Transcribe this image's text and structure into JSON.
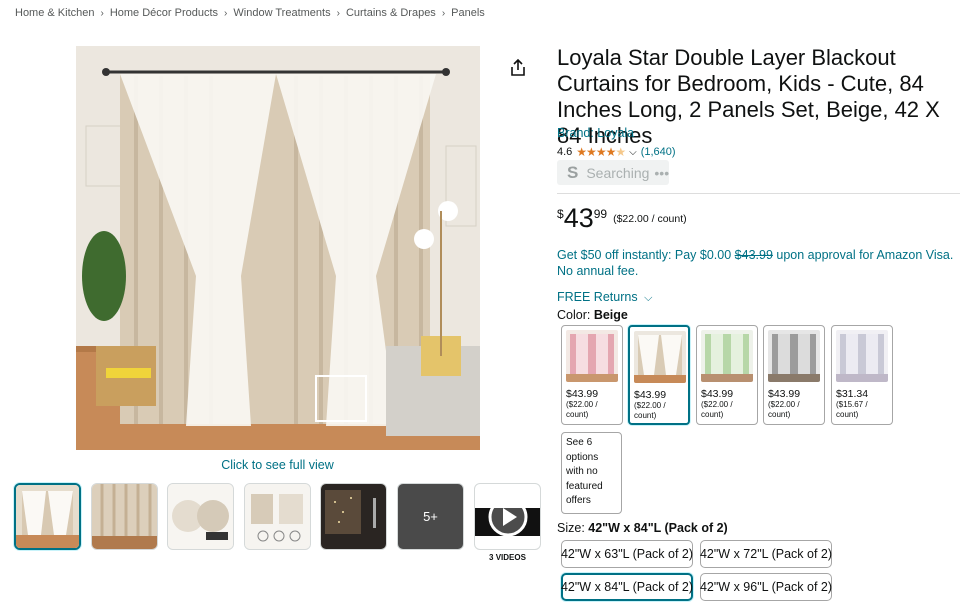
{
  "breadcrumb": [
    "Home & Kitchen",
    "Home Décor Products",
    "Window Treatments",
    "Curtains & Drapes",
    "Panels"
  ],
  "gallery": {
    "click_full_view": "Click to see full view",
    "more_count": "5+",
    "videos_label": "3 VIDEOS"
  },
  "product": {
    "title": "Loyala Star Double Layer Blackout Curtains for Bedroom, Kids - Cute, 84 Inches Long, 2 Panels Set, Beige, 42 X 84 Inches",
    "brand": "Brand: Loyala",
    "rating": "4.6",
    "rating_count": "(1,640)",
    "searching": "Searching",
    "price_symbol": "$",
    "price_whole": "43",
    "price_fraction": "99",
    "price_per_unit": "($22.00 / count)",
    "promo_prefix": "Get $50 off instantly: Pay $0.00 ",
    "promo_strike": "$43.99",
    "promo_suffix": " upon approval for Amazon Visa. No annual fee.",
    "free_returns": "FREE Returns",
    "color_label": "Color: ",
    "color_value": "Beige",
    "size_label": "Size: ",
    "size_value": "42\"W x 84\"L (Pack of 2)"
  },
  "swatches": [
    {
      "price": "$43.99",
      "unit": "($22.00 / count)",
      "color": "#e4a6b0"
    },
    {
      "price": "$43.99",
      "unit": "($22.00 / count)",
      "color": "#e6dccb"
    },
    {
      "price": "$43.99",
      "unit": "($22.00 / count)",
      "color": "#b7d7a8"
    },
    {
      "price": "$43.99",
      "unit": "($22.00 / count)",
      "color": "#9c9c9c"
    },
    {
      "price": "$31.34",
      "unit": "($15.67 / count)",
      "color": "#c9c9d6"
    }
  ],
  "more_options": "See 6 options with no featured offers",
  "sizes": [
    "42\"W x 63\"L (Pack of 2)",
    "42\"W x 72\"L (Pack of 2)",
    "42\"W x 84\"L (Pack of 2)",
    "42\"W x 96\"L (Pack of 2)"
  ],
  "colors": {
    "link": "#007185",
    "star": "#de7921",
    "selected_border": "#007185"
  }
}
